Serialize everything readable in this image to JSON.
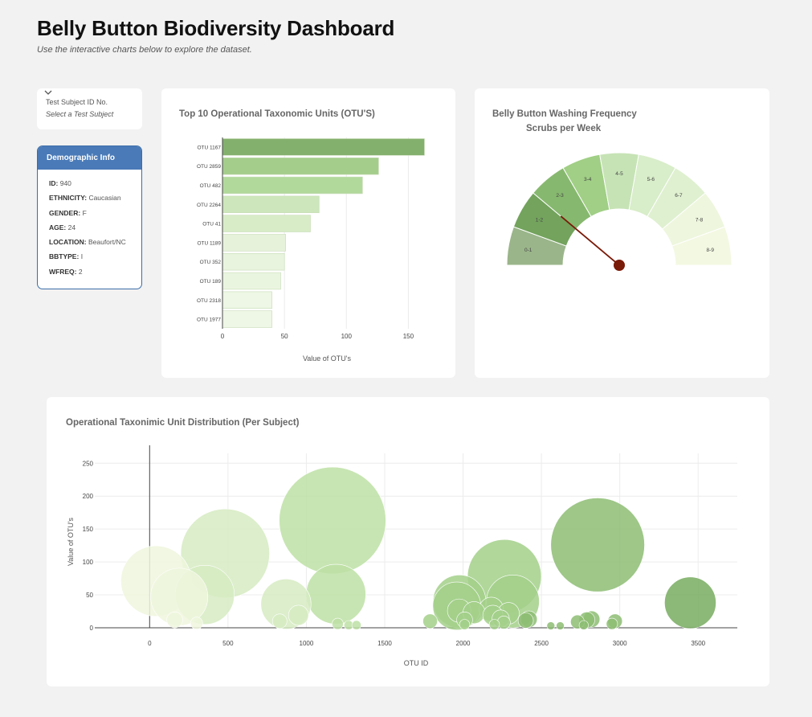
{
  "header": {
    "title": "Belly Button Biodiversity Dashboard",
    "subtitle": "Use the interactive charts below to explore the dataset."
  },
  "selector": {
    "label": "Test Subject ID No.",
    "placeholder": "Select a Test Subject",
    "icon": "chevron-down-icon"
  },
  "demographic": {
    "title": "Demographic Info",
    "rows": [
      {
        "key": "ID:",
        "value": "940"
      },
      {
        "key": "ETHNICITY:",
        "value": "Caucasian"
      },
      {
        "key": "GENDER:",
        "value": "F"
      },
      {
        "key": "AGE:",
        "value": "24"
      },
      {
        "key": "LOCATION:",
        "value": "Beaufort/NC"
      },
      {
        "key": "BBTYPE:",
        "value": "I"
      },
      {
        "key": "WFREQ:",
        "value": "2"
      }
    ],
    "border_color": "#3b6ea8",
    "header_color": "#4a7ab8"
  },
  "chart_data": [
    {
      "type": "bar",
      "orientation": "horizontal",
      "title": "Top 10 Operational Taxonomic Units (OTU'S)",
      "xlabel": "Value of OTU's",
      "ylabel": "",
      "categories": [
        "OTU 1167",
        "OTU 2859",
        "OTU 482",
        "OTU 2264",
        "OTU 41",
        "OTU 1189",
        "OTU 352",
        "OTU 189",
        "OTU 2318",
        "OTU 1977"
      ],
      "values": [
        163,
        126,
        113,
        78,
        71,
        51,
        50,
        47,
        40,
        40
      ],
      "xlim": [
        0,
        175
      ],
      "xticks": [
        0,
        50,
        100,
        150
      ],
      "colors": [
        "#84b06e",
        "#a4cd8c",
        "#b2d99c",
        "#cde6bb",
        "#d8ecc8",
        "#e6f2d9",
        "#e8f4dd",
        "#eaf5e0",
        "#eef7e5",
        "#eef7e5"
      ],
      "grid": true
    },
    {
      "type": "gauge",
      "title": "Belly Button Washing Frequency",
      "subtitle": "Scrubs per Week",
      "segments": [
        "0-1",
        "1-2",
        "2-3",
        "3-4",
        "4-5",
        "5-6",
        "6-7",
        "7-8",
        "8-9"
      ],
      "segment_colors": [
        "#9ab58a",
        "#73a35d",
        "#87b86f",
        "#a0cf85",
        "#c6e3b5",
        "#d8edc9",
        "#dff0d0",
        "#eef6de",
        "#f3f8e2"
      ],
      "value": 2,
      "range": [
        0,
        9
      ],
      "needle_color": "#7a1a08"
    },
    {
      "type": "scatter",
      "variant": "bubble",
      "title": "Operational Taxonimic Unit Distribution (Per Subject)",
      "xlabel": "OTU ID",
      "ylabel": "Value of OTU's",
      "xlim": [
        -350,
        3750
      ],
      "ylim": [
        0,
        265
      ],
      "xticks": [
        0,
        500,
        1000,
        1500,
        2000,
        2500,
        3000,
        3500
      ],
      "yticks": [
        0,
        50,
        100,
        150,
        200,
        250
      ],
      "grid": true,
      "points": [
        {
          "x": 41,
          "y": 71
        },
        {
          "x": 189,
          "y": 47
        },
        {
          "x": 352,
          "y": 50
        },
        {
          "x": 482,
          "y": 113
        },
        {
          "x": 1167,
          "y": 163
        },
        {
          "x": 1189,
          "y": 51
        },
        {
          "x": 2264,
          "y": 78
        },
        {
          "x": 2318,
          "y": 40
        },
        {
          "x": 2859,
          "y": 126
        },
        {
          "x": 1977,
          "y": 40
        },
        {
          "x": 3450,
          "y": 38
        },
        {
          "x": 870,
          "y": 36
        },
        {
          "x": 950,
          "y": 19
        },
        {
          "x": 1960,
          "y": 33
        },
        {
          "x": 1975,
          "y": 26
        },
        {
          "x": 2070,
          "y": 23
        },
        {
          "x": 2180,
          "y": 28
        },
        {
          "x": 2190,
          "y": 19
        },
        {
          "x": 2290,
          "y": 22
        },
        {
          "x": 2010,
          "y": 12
        },
        {
          "x": 2240,
          "y": 14
        },
        {
          "x": 160,
          "y": 12
        },
        {
          "x": 830,
          "y": 10
        },
        {
          "x": 1790,
          "y": 10
        },
        {
          "x": 2400,
          "y": 11
        },
        {
          "x": 2420,
          "y": 13
        },
        {
          "x": 2790,
          "y": 12
        },
        {
          "x": 2820,
          "y": 13
        },
        {
          "x": 2970,
          "y": 10
        },
        {
          "x": 2730,
          "y": 9
        },
        {
          "x": 2260,
          "y": 8
        },
        {
          "x": 300,
          "y": 7
        },
        {
          "x": 1200,
          "y": 6
        },
        {
          "x": 1270,
          "y": 4
        },
        {
          "x": 1320,
          "y": 4
        },
        {
          "x": 2010,
          "y": 5
        },
        {
          "x": 2200,
          "y": 5
        },
        {
          "x": 2770,
          "y": 4
        },
        {
          "x": 2950,
          "y": 6
        },
        {
          "x": 2560,
          "y": 3
        },
        {
          "x": 2620,
          "y": 3
        }
      ],
      "color_scale": [
        "#eef6dd",
        "#d6ebc2",
        "#bde0a4",
        "#a3d08a",
        "#8dbd73",
        "#78ab60"
      ]
    }
  ]
}
